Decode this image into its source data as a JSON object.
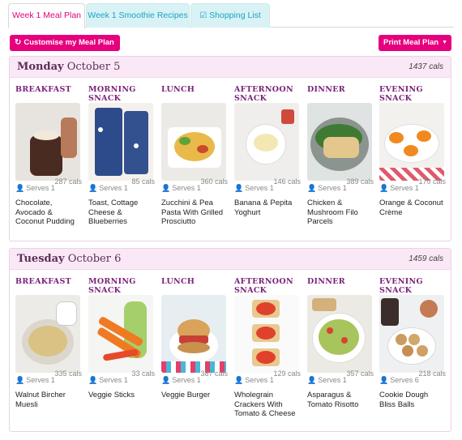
{
  "tabs": [
    {
      "label": "Week 1 Meal Plan",
      "icon": ""
    },
    {
      "label": "Week 1 Smoothie Recipes",
      "icon": ""
    },
    {
      "label": "Shopping List",
      "icon": "checkbox-icon"
    }
  ],
  "customise_label": "Customise my Meal Plan",
  "print_label": "Print Meal Plan",
  "colors": {
    "accent": "#e6007e",
    "header_bg": "#fbe8f6",
    "meal_label": "#7a1f78"
  },
  "days": [
    {
      "day": "Monday",
      "date": "October 5",
      "cals": "1437 cals",
      "meals": [
        {
          "label": "Breakfast",
          "serves": "Serves 1",
          "cals": "287 cals",
          "name": "Chocolate, Avocado & Coconut Pudding"
        },
        {
          "label": "Morning Snack",
          "serves": "Serves 1",
          "cals": "85 cals",
          "name": "Toast, Cottage Cheese & Blueberries"
        },
        {
          "label": "Lunch",
          "serves": "Serves 1",
          "cals": "360 cals",
          "name": "Zucchini & Pea Pasta With Grilled Prosciutto"
        },
        {
          "label": "Afternoon Snack",
          "serves": "Serves 1",
          "cals": "146 cals",
          "name": "Banana & Pepita Yoghurt"
        },
        {
          "label": "Dinner",
          "serves": "Serves 1",
          "cals": "389 cals",
          "name": "Chicken & Mushroom Filo Parcels"
        },
        {
          "label": "Evening Snack",
          "serves": "Serves 1",
          "cals": "170 cals",
          "name": "Orange & Coconut Crème"
        }
      ]
    },
    {
      "day": "Tuesday",
      "date": "October 6",
      "cals": "1459 cals",
      "meals": [
        {
          "label": "Breakfast",
          "serves": "Serves 1",
          "cals": "335 cals",
          "name": "Walnut Bircher Muesli"
        },
        {
          "label": "Morning Snack",
          "serves": "Serves 1",
          "cals": "33 cals",
          "name": "Veggie Sticks"
        },
        {
          "label": "Lunch",
          "serves": "Serves 1",
          "cals": "387 cals",
          "name": "Veggie Burger"
        },
        {
          "label": "Afternoon Snack",
          "serves": "Serves 1",
          "cals": "129 cals",
          "name": "Wholegrain Crackers With Tomato & Cheese"
        },
        {
          "label": "Dinner",
          "serves": "Serves 1",
          "cals": "357 cals",
          "name": "Asparagus & Tomato Risotto"
        },
        {
          "label": "Evening Snack",
          "serves": "Serves 6",
          "cals": "218 cals",
          "name": "Cookie Dough Bliss Balls"
        }
      ]
    }
  ]
}
